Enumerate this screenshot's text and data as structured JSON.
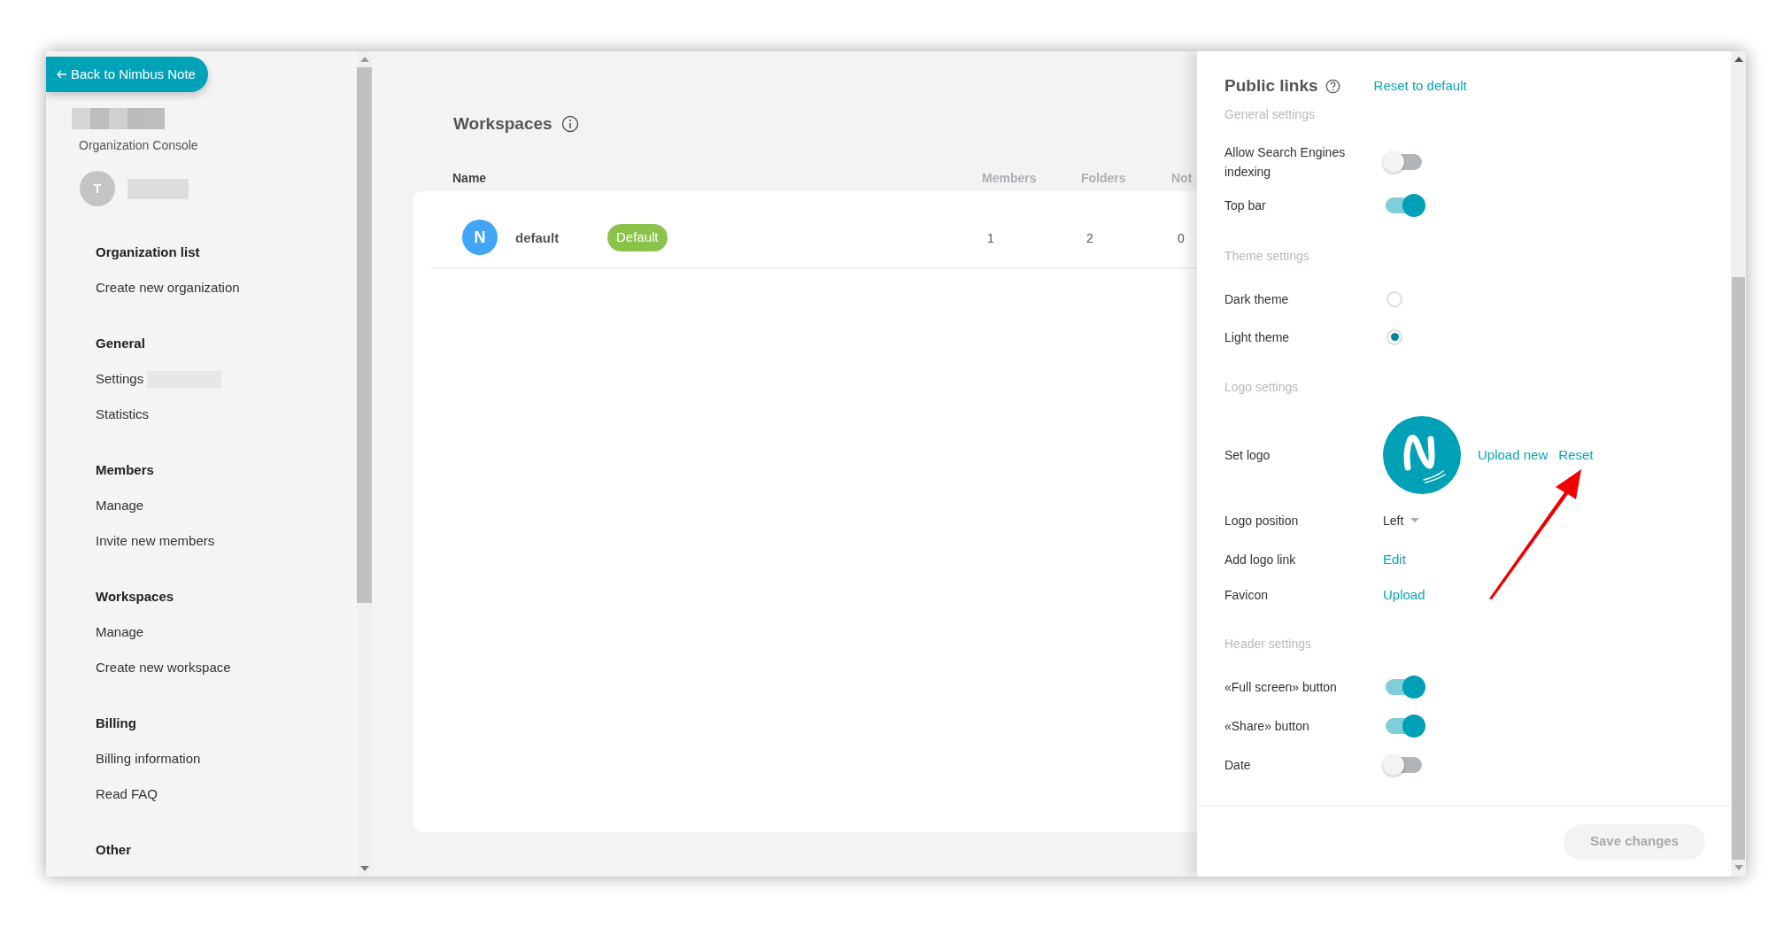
{
  "back_button": {
    "label": "Back to Nimbus Note"
  },
  "sidebar": {
    "subtitle": "Organization Console",
    "avatar_initial": "T",
    "sections": [
      {
        "title": "Organization list",
        "items": [
          "Create new organization"
        ]
      },
      {
        "title": "General",
        "items": [
          "Settings",
          "Statistics"
        ]
      },
      {
        "title": "Members",
        "items": [
          "Manage",
          "Invite new members"
        ]
      },
      {
        "title": "Workspaces",
        "items": [
          "Manage",
          "Create new workspace"
        ]
      },
      {
        "title": "Billing",
        "items": [
          "Billing information",
          "Read FAQ"
        ]
      },
      {
        "title": "Other"
      }
    ]
  },
  "main": {
    "title": "Workspaces",
    "columns": [
      "Name",
      "Members",
      "Folders",
      "Not"
    ],
    "rows": [
      {
        "initial": "N",
        "badge": "Default",
        "cells": [
          "default",
          "1",
          "2",
          "0"
        ]
      }
    ]
  },
  "panel": {
    "title": "Public links",
    "reset_link": "Reset to default",
    "sections": [
      {
        "title": "General settings",
        "rows": [
          {
            "kind": "toggle",
            "label": "Allow Search Engines indexing",
            "on": false
          },
          {
            "kind": "toggle",
            "label": "Top bar",
            "on": true
          }
        ]
      },
      {
        "title": "Theme settings",
        "rows": [
          {
            "kind": "radio",
            "label": "Dark theme",
            "selected": false
          },
          {
            "kind": "radio",
            "label": "Light theme",
            "selected": true
          }
        ]
      },
      {
        "title": "Logo settings",
        "rows": [
          {
            "kind": "logo",
            "label": "Set logo",
            "actions": [
              "Upload new",
              "Reset"
            ]
          },
          {
            "kind": "select",
            "label": "Logo position",
            "value": "Left"
          },
          {
            "kind": "link",
            "label": "Add logo link",
            "action": "Edit"
          },
          {
            "kind": "link",
            "label": "Favicon",
            "action": "Upload"
          }
        ]
      },
      {
        "title": "Header settings",
        "rows": [
          {
            "kind": "toggle",
            "label": "«Full screen» button",
            "on": true
          },
          {
            "kind": "toggle",
            "label": "«Share» button",
            "on": true
          },
          {
            "kind": "toggle",
            "label": "Date",
            "on": false
          }
        ]
      }
    ],
    "save_button": {
      "label": "Save changes",
      "disabled": true
    }
  }
}
